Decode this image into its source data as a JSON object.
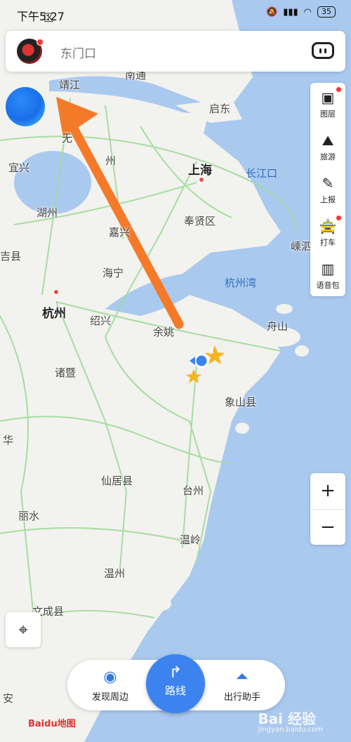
{
  "status": {
    "time": "下午5:27",
    "battery": "35"
  },
  "search": {
    "placeholder": "东门口"
  },
  "toolbar": {
    "layers": "图层",
    "travel": "旅游",
    "report": "上报",
    "taxi": "打车",
    "voice": "语音包"
  },
  "map_labels": {
    "top_district": "区",
    "jingjiang": "靖江",
    "nantong": "南通",
    "qidong": "启东",
    "yixing": "宜兴",
    "huzhou": "湖州",
    "anji": "吉县",
    "jiaxing": "嘉兴",
    "haining": "海宁",
    "shanghai": "上海",
    "fengxian": "奉贤区",
    "changjiangkou": "长江口",
    "hangzhouwan": "杭州湾",
    "shengsi": "嵊泗",
    "hangzhou": "杭州",
    "shaoxing": "绍兴",
    "yuyao": "余姚",
    "zhoushan": "舟山",
    "zhuji": "诸暨",
    "xiangshan": "象山县",
    "hua": "华",
    "xianju": "仙居县",
    "taizhou": "台州",
    "lishui": "丽水",
    "wenling": "温岭",
    "wenzhou": "温州",
    "wencheng": "文成县",
    "an": "安",
    "wuxi_part": "无",
    "su_part": "州",
    "cluster_count": "3"
  },
  "zoom": {
    "in": "+",
    "out": "−"
  },
  "bottom": {
    "discover": "发现周边",
    "route": "路线",
    "assistant": "出行助手"
  },
  "logo": {
    "text": "Bai",
    "du": "du",
    "map": "地图"
  },
  "watermark": {
    "text": "Bai 经验",
    "sub": "jingyan.baidu.com"
  },
  "colors": {
    "accent": "#3d83f0",
    "arrow": "#f47a2a",
    "water": "#aac9ef",
    "land": "#f2f2ee",
    "roads": "#9edb9a"
  }
}
